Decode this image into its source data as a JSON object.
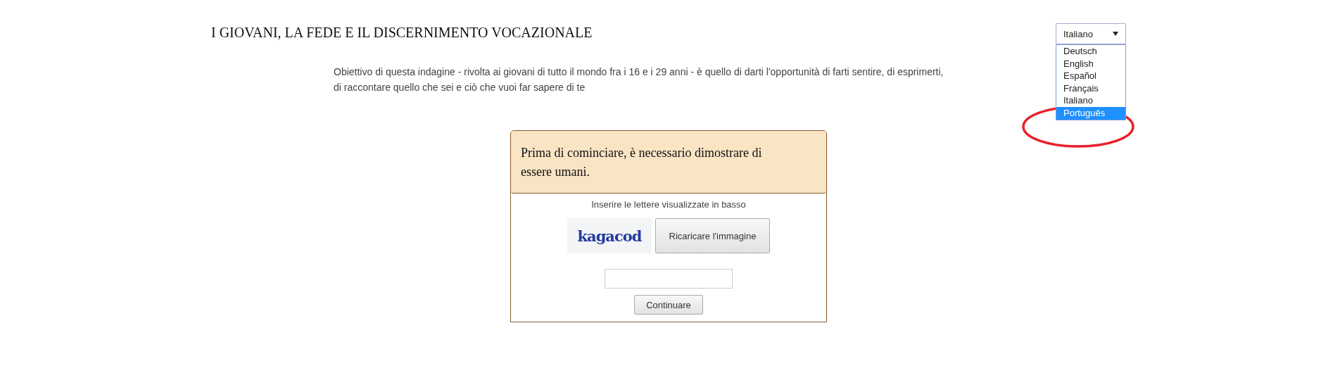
{
  "title": "I GIOVANI, LA FEDE E IL DISCERNIMENTO VOCAZIONALE",
  "language_select": {
    "value": "Italiano",
    "expanded": true,
    "options": [
      {
        "label": "Deutsch",
        "highlighted": false
      },
      {
        "label": "English",
        "highlighted": false
      },
      {
        "label": "Español",
        "highlighted": false
      },
      {
        "label": "Français",
        "highlighted": false
      },
      {
        "label": "Italiano",
        "highlighted": false
      },
      {
        "label": "Português",
        "highlighted": true
      }
    ]
  },
  "intro": "Obiettivo di questa indagine - rivolta ai giovani di tutto il mondo fra i 16 e i 29 anni - è quello di darti l'opportunità di farti sentire, di esprimerti, di raccontare quello che sei e ciò che vuoi far sapere di te",
  "captcha": {
    "header": "Prima di cominciare, è necessario dimostrare di essere umani.",
    "instruction": "Inserire le lettere visualizzate in basso",
    "code": "kagacod",
    "reload_button": "Ricaricare l'immagine",
    "continue_button": "Continuare"
  }
}
